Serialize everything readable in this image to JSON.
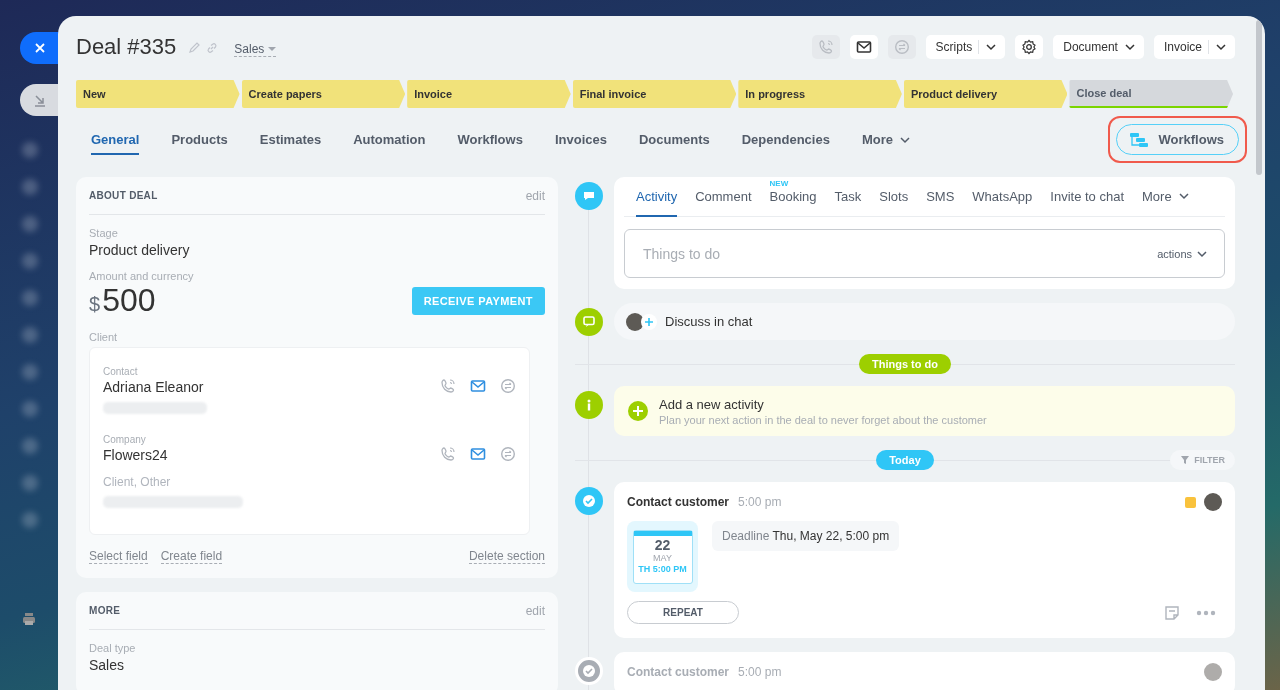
{
  "deal": {
    "title": "Deal #335",
    "category": "Sales"
  },
  "icon_buttons": [
    {
      "disabled": true
    },
    {
      "disabled": false
    },
    {
      "disabled": true
    }
  ],
  "menus": [
    {
      "label": "Scripts",
      "split": true
    },
    {
      "label": "Document",
      "split": false
    },
    {
      "label": "Invoice",
      "split": true
    }
  ],
  "stages": [
    {
      "label": "New",
      "reached": true,
      "kind": "progress"
    },
    {
      "label": "Create papers",
      "reached": true,
      "kind": "progress"
    },
    {
      "label": "Invoice",
      "reached": true,
      "kind": "progress"
    },
    {
      "label": "Final invoice",
      "reached": true,
      "kind": "progress"
    },
    {
      "label": "In progress",
      "reached": true,
      "kind": "progress"
    },
    {
      "label": "Product delivery",
      "reached": true,
      "kind": "progress"
    },
    {
      "label": "Close deal",
      "reached": false,
      "kind": "success"
    }
  ],
  "tabs": [
    {
      "label": "General",
      "selected": true,
      "kind": "tab"
    },
    {
      "label": "Products",
      "selected": false,
      "kind": "tab"
    },
    {
      "label": "Estimates",
      "selected": false,
      "kind": "tab"
    },
    {
      "label": "Automation",
      "selected": false,
      "kind": "tab"
    },
    {
      "label": "Workflows",
      "selected": false,
      "kind": "tab"
    },
    {
      "label": "Invoices",
      "selected": false,
      "kind": "tab"
    },
    {
      "label": "Documents",
      "selected": false,
      "kind": "tab"
    },
    {
      "label": "Dependencies",
      "selected": false,
      "kind": "tab"
    },
    {
      "label": "More",
      "selected": false,
      "kind": "menu"
    }
  ],
  "workflows_button": {
    "label": "Workflows",
    "highlighted": true
  },
  "about_card": {
    "title": "ABOUT DEAL",
    "edit": "edit",
    "fields": [
      {
        "label": "Stage",
        "value": "Product delivery"
      }
    ],
    "amount": {
      "label": "Amount and currency",
      "currency": "$",
      "value": "500"
    },
    "payment_button": "RECEIVE PAYMENT",
    "client": {
      "label": "Client",
      "entries": [
        {
          "label": "Contact",
          "name": "Adriana Eleanor"
        },
        {
          "label": "Company",
          "name": "Flowers24",
          "note": "Client, Other"
        }
      ]
    },
    "links": [
      "Select field",
      "Create field"
    ],
    "delete_link": "Delete section"
  },
  "more_card": {
    "title": "MORE",
    "edit": "edit",
    "fields": [
      {
        "label": "Deal type",
        "value": "Sales"
      }
    ]
  },
  "composer": {
    "tabs": [
      {
        "label": "Activity",
        "selected": true,
        "kind": "tab"
      },
      {
        "label": "Comment",
        "selected": false,
        "kind": "tab"
      },
      {
        "label": "Booking",
        "selected": false,
        "kind": "tab",
        "badge": "NEW"
      },
      {
        "label": "Task",
        "selected": false,
        "kind": "tab"
      },
      {
        "label": "Slots",
        "selected": false,
        "kind": "tab"
      },
      {
        "label": "SMS",
        "selected": false,
        "kind": "tab"
      },
      {
        "label": "WhatsApp",
        "selected": false,
        "kind": "tab"
      },
      {
        "label": "Invite to chat",
        "selected": false,
        "kind": "tab"
      },
      {
        "label": "More",
        "selected": false,
        "kind": "menu"
      }
    ],
    "placeholder": "Things to do",
    "actions": "actions"
  },
  "chat": {
    "label": "Discuss in chat"
  },
  "planned_divider": "Things to do",
  "add_activity": {
    "title": "Add a new activity",
    "hint": "Plan your next action in the deal to never forget about the customer"
  },
  "today_divider": "Today",
  "filter": "FILTER",
  "activities": [
    {
      "title": "Contact customer",
      "time": "5:00 pm",
      "faded": false,
      "color": "#f9c23c",
      "calendar": {
        "day": "22",
        "month": "MAY",
        "time": "TH 5:00 PM"
      },
      "deadline_label": "Deadline",
      "deadline": "Thu, May 22, 5:00 pm",
      "repeat": "REPEAT"
    },
    {
      "title": "Contact customer",
      "time": "5:00 pm",
      "faded": true
    }
  ]
}
